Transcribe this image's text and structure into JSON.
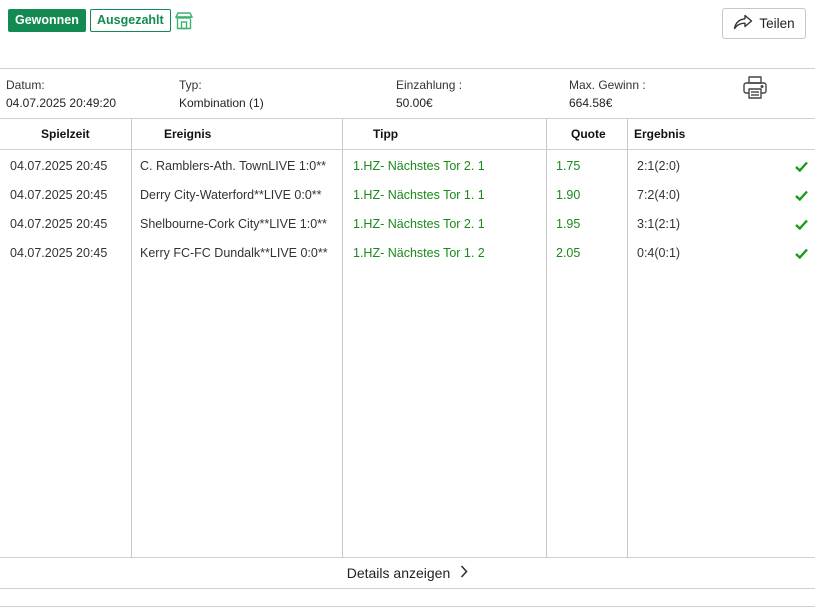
{
  "header": {
    "status_won": "Gewonnen",
    "status_paid": "Ausgezahlt",
    "share_label": "Teilen",
    "icons": {
      "shop": "shop-icon",
      "share": "share-arrow-icon",
      "print": "printer-icon"
    },
    "colors": {
      "accent": "#138a52",
      "tipp_text": "#1a8a1a"
    }
  },
  "meta": {
    "date_label": "Datum:",
    "date_value": "04.07.2025 20:49:20",
    "type_label": "Typ:",
    "type_value": "Kombination (1)",
    "deposit_label": "Einzahlung :",
    "deposit_value": "50.00€",
    "maxwin_label": "Max. Gewinn :",
    "maxwin_value": "664.58€"
  },
  "table": {
    "headers": {
      "time": "Spielzeit",
      "event": "Ereignis",
      "tipp": "Tipp",
      "quote": "Quote",
      "result": "Ergebnis"
    },
    "rows": [
      {
        "time": "04.07.2025 20:45",
        "event": "C. Ramblers-Ath. TownLIVE 1:0**",
        "tipp": "1.HZ- Nächstes Tor 2. 1",
        "quote": "1.75",
        "result": "2:1(2:0)",
        "status": "won"
      },
      {
        "time": "04.07.2025 20:45",
        "event": "Derry City-Waterford**LIVE 0:0**",
        "tipp": "1.HZ- Nächstes Tor 1. 1",
        "quote": "1.90",
        "result": "7:2(4:0)",
        "status": "won"
      },
      {
        "time": "04.07.2025 20:45",
        "event": "Shelbourne-Cork City**LIVE 1:0**",
        "tipp": "1.HZ- Nächstes Tor 2. 1",
        "quote": "1.95",
        "result": "3:1(2:1)",
        "status": "won"
      },
      {
        "time": "04.07.2025 20:45",
        "event": "Kerry FC-FC Dundalk**LIVE 0:0**",
        "tipp": "1.HZ- Nächstes Tor 1. 2",
        "quote": "2.05",
        "result": "0:4(0:1)",
        "status": "won"
      }
    ]
  },
  "footer": {
    "details_label": "Details anzeigen"
  }
}
